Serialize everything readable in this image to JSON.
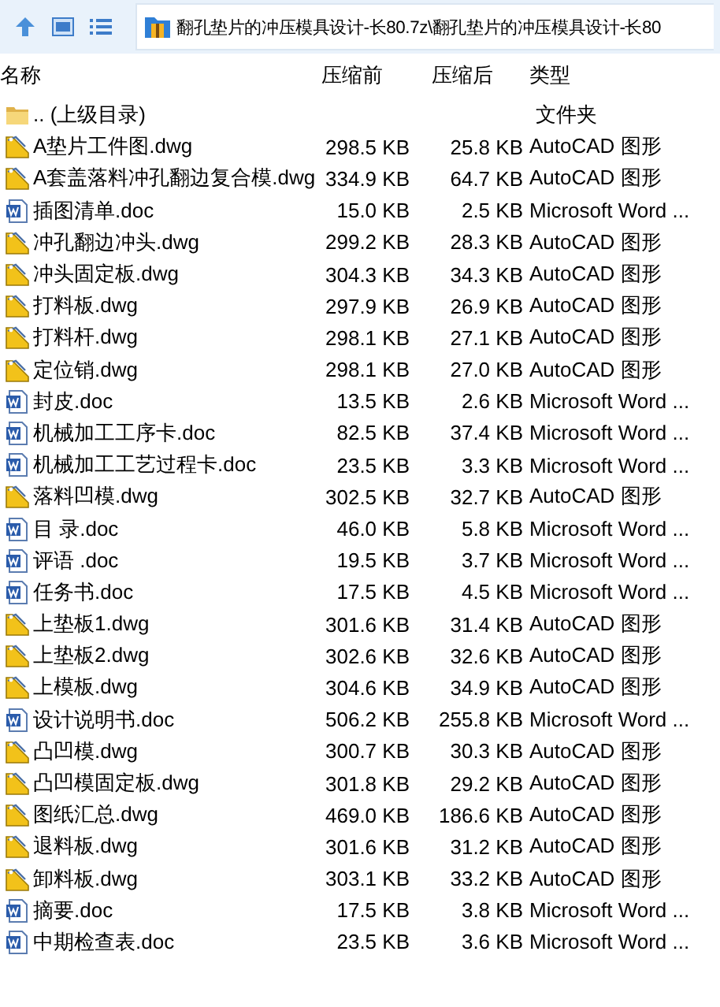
{
  "toolbar": {
    "address": "翻孔垫片的冲压模具设计-长80.7z\\翻孔垫片的冲压模具设计-长80"
  },
  "columns": [
    "名称",
    "压缩前",
    "压缩后",
    "类型"
  ],
  "rows": [
    {
      "kind": "parent",
      "name": ".. (上级目录)",
      "size": "",
      "packed": "",
      "type": "文件夹"
    },
    {
      "kind": "dwg",
      "name": "A垫片工件图.dwg",
      "size": "298.5 KB",
      "packed": "25.8 KB",
      "type": "AutoCAD 图形"
    },
    {
      "kind": "dwg",
      "name": "A套盖落料冲孔翻边复合模.dwg",
      "size": "334.9 KB",
      "packed": "64.7 KB",
      "type": "AutoCAD 图形"
    },
    {
      "kind": "doc",
      "name": "插图清单.doc",
      "size": "15.0 KB",
      "packed": "2.5 KB",
      "type": "Microsoft Word ..."
    },
    {
      "kind": "dwg",
      "name": "冲孔翻边冲头.dwg",
      "size": "299.2 KB",
      "packed": "28.3 KB",
      "type": "AutoCAD 图形"
    },
    {
      "kind": "dwg",
      "name": "冲头固定板.dwg",
      "size": "304.3 KB",
      "packed": "34.3 KB",
      "type": "AutoCAD 图形"
    },
    {
      "kind": "dwg",
      "name": "打料板.dwg",
      "size": "297.9 KB",
      "packed": "26.9 KB",
      "type": "AutoCAD 图形"
    },
    {
      "kind": "dwg",
      "name": "打料杆.dwg",
      "size": "298.1 KB",
      "packed": "27.1 KB",
      "type": "AutoCAD 图形"
    },
    {
      "kind": "dwg",
      "name": "定位销.dwg",
      "size": "298.1 KB",
      "packed": "27.0 KB",
      "type": "AutoCAD 图形"
    },
    {
      "kind": "doc",
      "name": "封皮.doc",
      "size": "13.5 KB",
      "packed": "2.6 KB",
      "type": "Microsoft Word ..."
    },
    {
      "kind": "doc",
      "name": "机械加工工序卡.doc",
      "size": "82.5 KB",
      "packed": "37.4 KB",
      "type": "Microsoft Word ..."
    },
    {
      "kind": "doc",
      "name": "机械加工工艺过程卡.doc",
      "size": "23.5 KB",
      "packed": "3.3 KB",
      "type": "Microsoft Word ..."
    },
    {
      "kind": "dwg",
      "name": "落料凹模.dwg",
      "size": "302.5 KB",
      "packed": "32.7 KB",
      "type": "AutoCAD 图形"
    },
    {
      "kind": "doc",
      "name": "目 录.doc",
      "size": "46.0 KB",
      "packed": "5.8 KB",
      "type": "Microsoft Word ..."
    },
    {
      "kind": "doc",
      "name": "评语 .doc",
      "size": "19.5 KB",
      "packed": "3.7 KB",
      "type": "Microsoft Word ..."
    },
    {
      "kind": "doc",
      "name": "任务书.doc",
      "size": "17.5 KB",
      "packed": "4.5 KB",
      "type": "Microsoft Word ..."
    },
    {
      "kind": "dwg",
      "name": "上垫板1.dwg",
      "size": "301.6 KB",
      "packed": "31.4 KB",
      "type": "AutoCAD 图形"
    },
    {
      "kind": "dwg",
      "name": "上垫板2.dwg",
      "size": "302.6 KB",
      "packed": "32.6 KB",
      "type": "AutoCAD 图形"
    },
    {
      "kind": "dwg",
      "name": "上模板.dwg",
      "size": "304.6 KB",
      "packed": "34.9 KB",
      "type": "AutoCAD 图形"
    },
    {
      "kind": "doc",
      "name": "设计说明书.doc",
      "size": "506.2 KB",
      "packed": "255.8 KB",
      "type": "Microsoft Word ..."
    },
    {
      "kind": "dwg",
      "name": "凸凹模.dwg",
      "size": "300.7 KB",
      "packed": "30.3 KB",
      "type": "AutoCAD 图形"
    },
    {
      "kind": "dwg",
      "name": "凸凹模固定板.dwg",
      "size": "301.8 KB",
      "packed": "29.2 KB",
      "type": "AutoCAD 图形"
    },
    {
      "kind": "dwg",
      "name": "图纸汇总.dwg",
      "size": "469.0 KB",
      "packed": "186.6 KB",
      "type": "AutoCAD 图形"
    },
    {
      "kind": "dwg",
      "name": "退料板.dwg",
      "size": "301.6 KB",
      "packed": "31.2 KB",
      "type": "AutoCAD 图形"
    },
    {
      "kind": "dwg",
      "name": "卸料板.dwg",
      "size": "303.1 KB",
      "packed": "33.2 KB",
      "type": "AutoCAD 图形"
    },
    {
      "kind": "doc",
      "name": "摘要.doc",
      "size": "17.5 KB",
      "packed": "3.8 KB",
      "type": "Microsoft Word ..."
    },
    {
      "kind": "doc",
      "name": "中期检查表.doc",
      "size": "23.5 KB",
      "packed": "3.6 KB",
      "type": "Microsoft Word ..."
    }
  ]
}
